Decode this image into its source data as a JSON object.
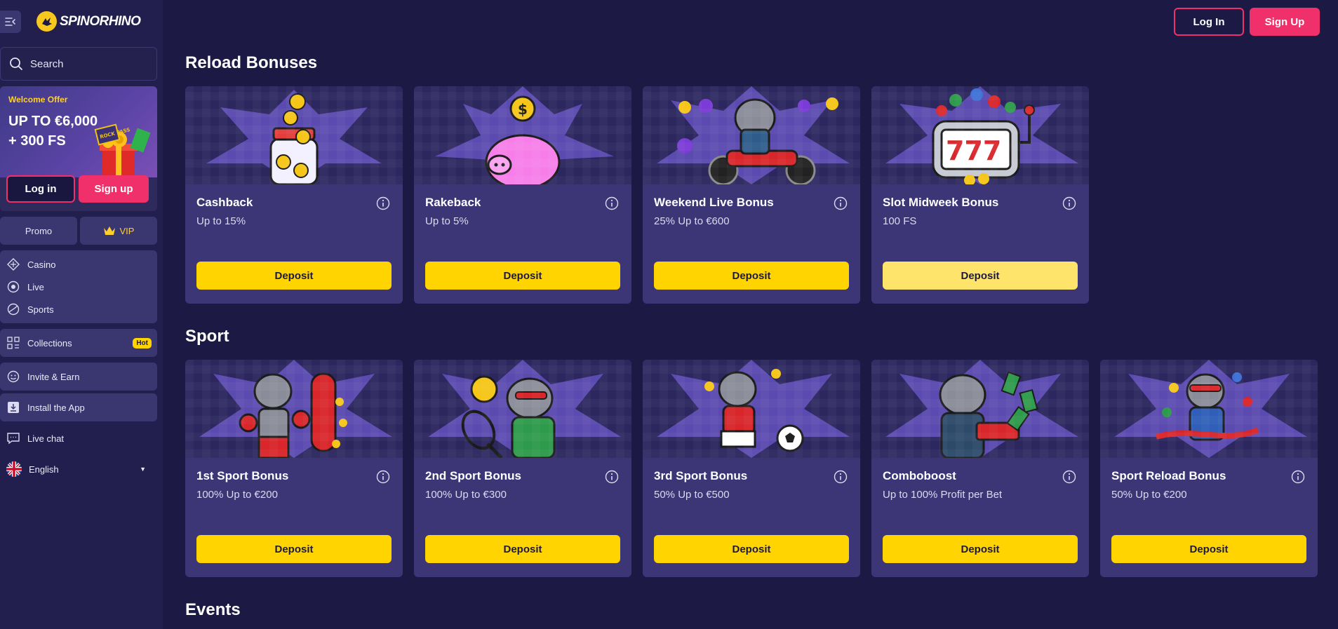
{
  "brand": {
    "name": "SPINORHINO"
  },
  "sidebar": {
    "search_placeholder": "Search",
    "welcome": {
      "label": "Welcome Offer",
      "line1": "UP TO €6,000",
      "line2": "+ 300 FS",
      "badge_text": "ROCK PASS"
    },
    "login_label": "Log in",
    "signup_label": "Sign up",
    "promo_label": "Promo",
    "vip_label": "VIP",
    "nav": [
      {
        "label": "Casino",
        "icon": "casino-icon"
      },
      {
        "label": "Live",
        "icon": "live-icon"
      },
      {
        "label": "Sports",
        "icon": "sports-icon"
      }
    ],
    "collections_label": "Collections",
    "hot_badge": "Hot",
    "invite_label": "Invite & Earn",
    "install_label": "Install the App",
    "live_chat_label": "Live chat",
    "language_label": "English"
  },
  "header": {
    "login_label": "Log In",
    "signup_label": "Sign Up"
  },
  "sections": {
    "reload": {
      "title": "Reload Bonuses",
      "cards": [
        {
          "title": "Cashback",
          "subtitle": "Up to 15%",
          "button": "Deposit",
          "art": "coin-jar"
        },
        {
          "title": "Rakeback",
          "subtitle": "Up to 5%",
          "button": "Deposit",
          "art": "piggy-bank"
        },
        {
          "title": "Weekend Live Bonus",
          "subtitle": "25% Up to €600",
          "button": "Deposit",
          "art": "rhino-motorcycle"
        },
        {
          "title": "Slot Midweek Bonus",
          "subtitle": "100 FS",
          "button": "Deposit",
          "art": "slot-machine"
        }
      ]
    },
    "sport": {
      "title": "Sport",
      "cards": [
        {
          "title": "1st Sport Bonus",
          "subtitle": "100% Up to €200",
          "button": "Deposit",
          "art": "rhino-boxer"
        },
        {
          "title": "2nd Sport Bonus",
          "subtitle": "100% Up to €300",
          "button": "Deposit",
          "art": "rhino-tennis"
        },
        {
          "title": "3rd Sport Bonus",
          "subtitle": "50% Up to €500",
          "button": "Deposit",
          "art": "rhino-football"
        },
        {
          "title": "Comboboost",
          "subtitle": "Up to 100% Profit per Bet",
          "button": "Deposit",
          "art": "rhino-money-gun"
        },
        {
          "title": "Sport Reload Bonus",
          "subtitle": "50% Up to €200",
          "button": "Deposit",
          "art": "rhino-runner"
        }
      ]
    },
    "events": {
      "title": "Events"
    }
  },
  "colors": {
    "background": "#1c1a44",
    "sidebar": "#221f4e",
    "card": "#3c3676",
    "accent_pink": "#f0306a",
    "accent_yellow": "#ffd400"
  }
}
